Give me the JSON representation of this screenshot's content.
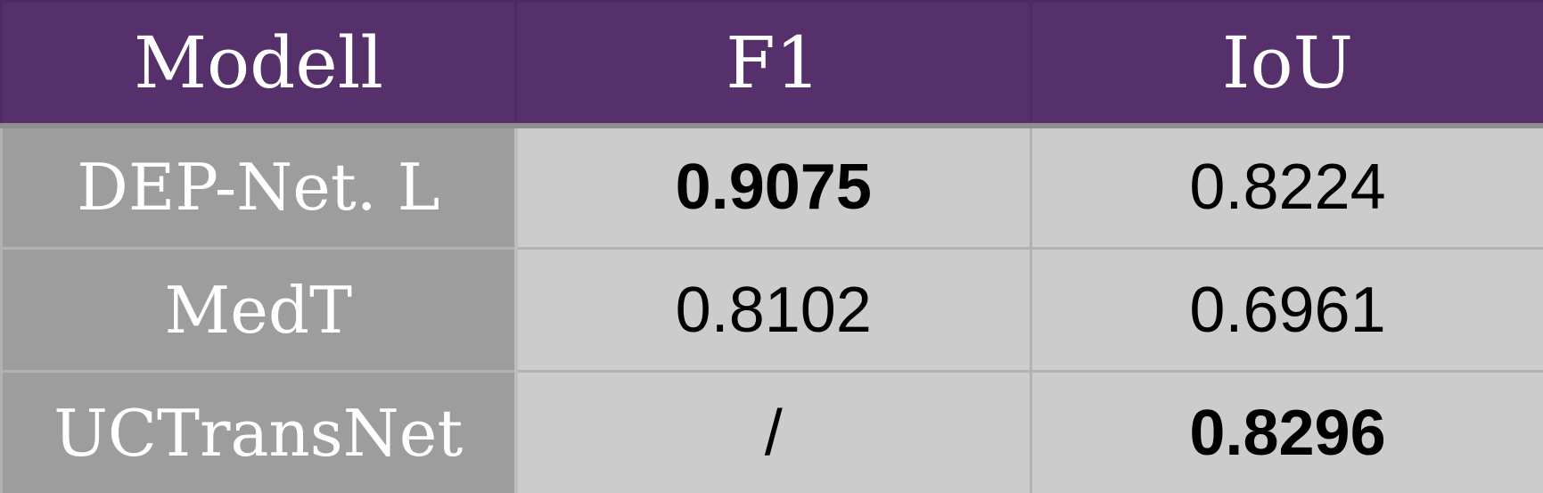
{
  "table": {
    "headers": [
      "Modell",
      "F1",
      "IoU"
    ],
    "rows": [
      {
        "model": "DEP-Net. L",
        "f1": "0.9075",
        "iou": "0.8224"
      },
      {
        "model": "MedT",
        "f1": "0.8102",
        "iou": "0.6961"
      },
      {
        "model": "UCTransNet",
        "f1": "/",
        "iou": "0.8296"
      }
    ],
    "bold_cells": [
      "rows.0.f1",
      "rows.2.iou"
    ]
  },
  "colors": {
    "header_bg": "#56306b",
    "header_text": "#ffffff",
    "model_col_bg": "#9d9d9d",
    "value_bg": "#cccccc",
    "grid_line": "#b2b2b2"
  }
}
